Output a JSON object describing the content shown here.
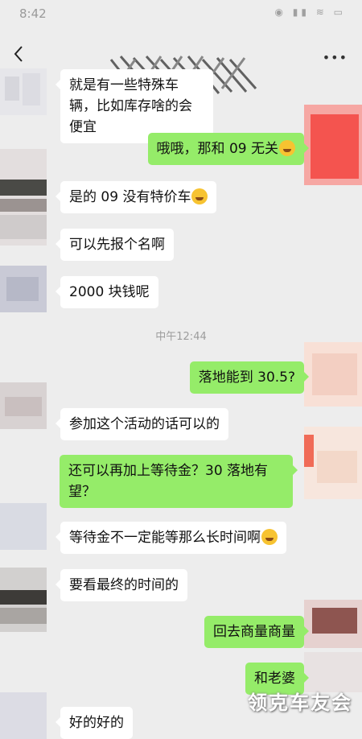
{
  "status_bar": {
    "time": "8:42",
    "icons": "◉ ▮▮ ≋ ▭"
  },
  "nav": {
    "more_label": "•••"
  },
  "time_divider": "中午12:44",
  "messages": [
    {
      "side": "in",
      "text": "就是有一些特殊车辆，比如库存啥的会便宜",
      "emoji": false
    },
    {
      "side": "out",
      "text": "哦哦，那和 09 无关",
      "emoji": true
    },
    {
      "side": "in",
      "text": "是的 09 没有特价车",
      "emoji": true
    },
    {
      "side": "in",
      "text": "可以先报个名啊",
      "emoji": false
    },
    {
      "side": "in",
      "text": "2000 块钱呢",
      "emoji": false
    },
    {
      "side": "out",
      "text": "落地能到 30.5?",
      "emoji": false
    },
    {
      "side": "in",
      "text": "参加这个活动的话可以的",
      "emoji": false
    },
    {
      "side": "out",
      "text": "还可以再加上等待金？30 落地有望？",
      "emoji": false
    },
    {
      "side": "in",
      "text": "等待金不一定能等那么长时间啊",
      "emoji": true
    },
    {
      "side": "in",
      "text": "要看最终的时间的",
      "emoji": false
    },
    {
      "side": "out",
      "text": "回去商量商量",
      "emoji": false
    },
    {
      "side": "out",
      "text": "和老婆",
      "emoji": false
    },
    {
      "side": "in",
      "text": "好的好的",
      "emoji": false
    }
  ],
  "watermark": "领克车友会",
  "colors": {
    "background": "#ededed",
    "bubble_out": "#95ec69",
    "bubble_in": "#ffffff"
  },
  "icons": {
    "back": "chevron-left-icon",
    "more": "more-icon"
  }
}
